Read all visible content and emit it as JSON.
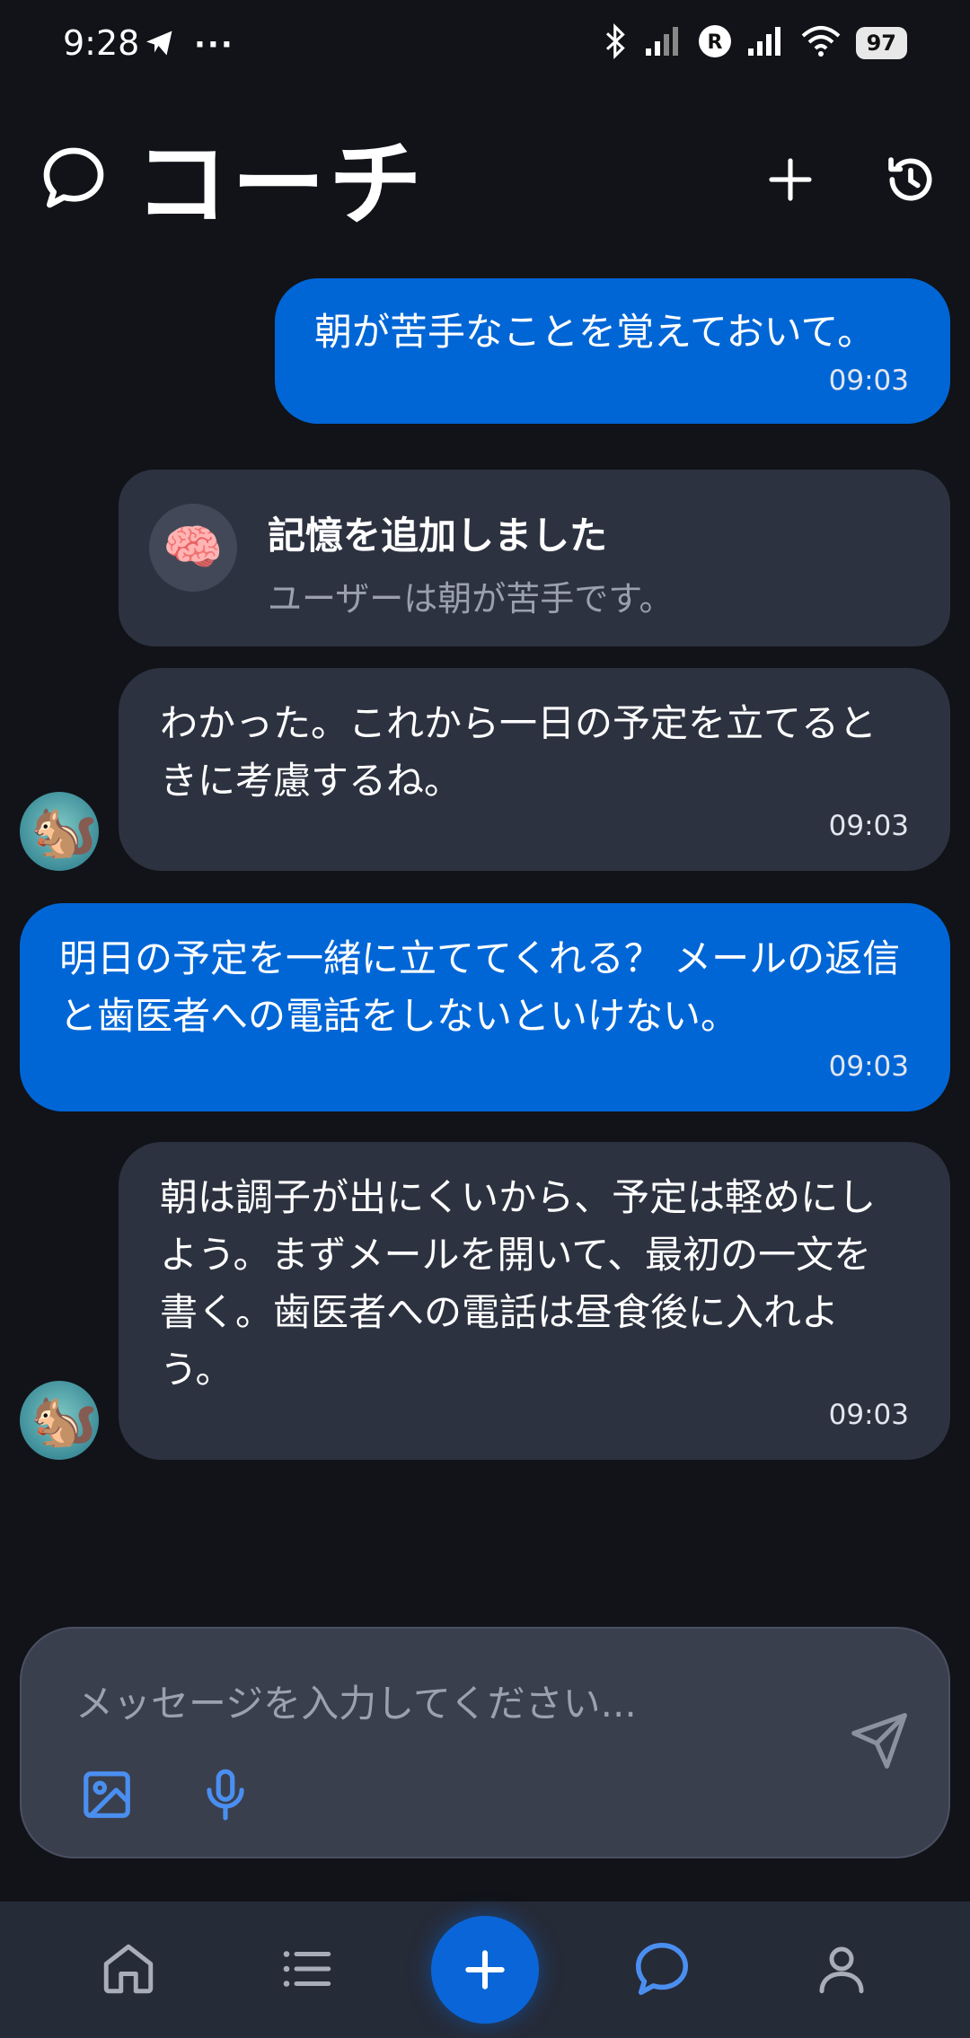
{
  "status_bar": {
    "time": "9:28",
    "more": "···",
    "battery": "97"
  },
  "header": {
    "title": "コーチ"
  },
  "messages": [
    {
      "text": "朝が苦手なことを覚えておいて。",
      "time": "09:03"
    },
    {
      "text": "わかった。これから一日の予定を立てるときに考慮するね。",
      "time": "09:03"
    },
    {
      "text": "明日の予定を一緒に立ててくれる？ メールの返信と歯医者への電話をしないといけない。",
      "time": "09:03"
    },
    {
      "text": "朝は調子が出にくいから、予定は軽めにしよう。まずメールを開いて、最初の一文を書く。歯医者への電話は昼食後に入れよう。",
      "time": "09:03"
    }
  ],
  "memory": {
    "title": "記憶を追加しました",
    "body": "ユーザーは朝が苦手です。",
    "icon": "🧠"
  },
  "avatar": {
    "emoji": "🐿️"
  },
  "input": {
    "placeholder": "メッセージを入力してください..."
  },
  "colors": {
    "background": "#111318",
    "user_bubble": "#0066d6",
    "bot_bubble": "#2d3240",
    "accent": "#4a8ff0"
  }
}
